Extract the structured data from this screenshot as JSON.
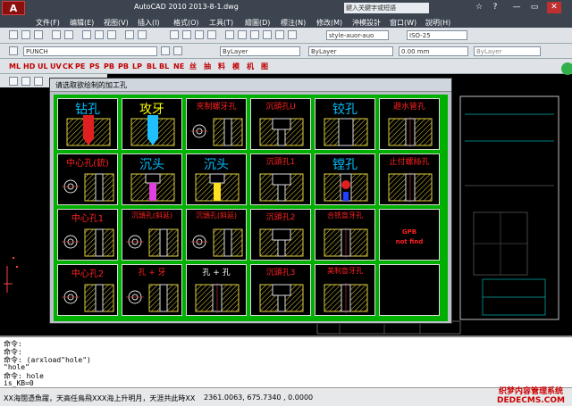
{
  "window": {
    "title": "AutoCAD 2010    2013-8-1.dwg",
    "search_placeholder": "鍵入关鍵字或短語",
    "app_button": "A"
  },
  "window_controls": [
    "☆",
    "?",
    "—",
    "▭",
    "✕"
  ],
  "menu": [
    "文件(F)",
    "编辑(E)",
    "视图(V)",
    "插入(I)",
    "格式(O)",
    "工具(T)",
    "繪圖(D)",
    "標注(N)",
    "修改(M)",
    "沖模設計",
    "窗口(W)",
    "說明(H)"
  ],
  "toolbar": {
    "layer": "PUNCH",
    "text_style": "style-auor-auo",
    "dim_style": "ISO-25",
    "color": "ByLayer",
    "linetype": "ByLayer",
    "lineweight": "0.00 mm",
    "plotstyle": "ByLayer"
  },
  "red_tools": [
    "ML",
    "HD",
    "UL",
    "UV",
    "CK",
    "PE",
    "PS",
    "PB",
    "PB",
    "LP",
    "BL",
    "BL",
    "NE",
    "丝",
    "抽",
    "料",
    "模",
    "机",
    "图"
  ],
  "dialog": {
    "title": "请选取欲绘制的加工孔",
    "cells": [
      {
        "label": "钻孔",
        "color": "#00c0ff",
        "size": 14,
        "shape": "drill"
      },
      {
        "label": "攻牙",
        "color": "#ffff00",
        "size": 14,
        "shape": "tap"
      },
      {
        "label": "夾制螺牙孔",
        "color": "#ff2020",
        "size": 9,
        "shape": "thread"
      },
      {
        "label": "沉頭孔U",
        "color": "#ff2020",
        "size": 9,
        "shape": "cbore"
      },
      {
        "label": "铰孔",
        "color": "#00c0ff",
        "size": 14,
        "shape": "ream"
      },
      {
        "label": "避水管孔",
        "color": "#ff2020",
        "size": 9,
        "shape": "pipe"
      },
      {
        "label": "中心孔(銃)",
        "color": "#ff2020",
        "size": 10,
        "shape": "center"
      },
      {
        "label": "沉头",
        "color": "#00c0ff",
        "size": 14,
        "shape": "csink"
      },
      {
        "label": "沉头",
        "color": "#00c0ff",
        "size": 14,
        "shape": "csink2"
      },
      {
        "label": "沉頭孔1",
        "color": "#ff2020",
        "size": 9,
        "shape": "cbore"
      },
      {
        "label": "镗孔",
        "color": "#00c0ff",
        "size": 14,
        "shape": "bore"
      },
      {
        "label": "止付螺絲孔",
        "color": "#ff2020",
        "size": 9,
        "shape": "set"
      },
      {
        "label": "中心孔1",
        "color": "#ff2020",
        "size": 10,
        "shape": "center"
      },
      {
        "label": "沉頭孔(斜延)",
        "color": "#ff2020",
        "size": 8,
        "shape": "slant"
      },
      {
        "label": "沉頭孔(斜延)",
        "color": "#ff2020",
        "size": 8,
        "shape": "slant"
      },
      {
        "label": "沉頭孔2",
        "color": "#ff2020",
        "size": 9,
        "shape": "cbore"
      },
      {
        "label": "合铣盲牙孔",
        "color": "#ff2020",
        "size": 8,
        "shape": "blind"
      },
      {
        "label": "GPB\nnot find",
        "color": "#ff2020",
        "size": 7,
        "shape": "none"
      },
      {
        "label": "中心孔2",
        "color": "#ff2020",
        "size": 10,
        "shape": "center"
      },
      {
        "label": "孔 + 牙",
        "color": "#ff2020",
        "size": 9,
        "shape": "holetap"
      },
      {
        "label": "孔 + 孔",
        "color": "#ffffff",
        "size": 9,
        "shape": "holehole"
      },
      {
        "label": "沉頭孔3",
        "color": "#ff2020",
        "size": 9,
        "shape": "cbore"
      },
      {
        "label": "美制盲牙孔",
        "color": "#ff2020",
        "size": 8,
        "shape": "blind"
      },
      {
        "label": "",
        "color": "#ff2020",
        "size": 8,
        "shape": "empty"
      }
    ]
  },
  "command": {
    "lines": [
      "命令:",
      "命令:",
      "命令: (arxload\"hole\")",
      "\"hole\"",
      "命令: hole",
      "  is_KB=0"
    ]
  },
  "status": {
    "text": "XX海闊憑魚躍，天高任鳥飛XXX海上升明月，天涯共此時XX",
    "coords": "2361.0063, 675.7340 , 0.0000"
  },
  "watermark": "织梦内容管理系统 DEDECMS.COM"
}
